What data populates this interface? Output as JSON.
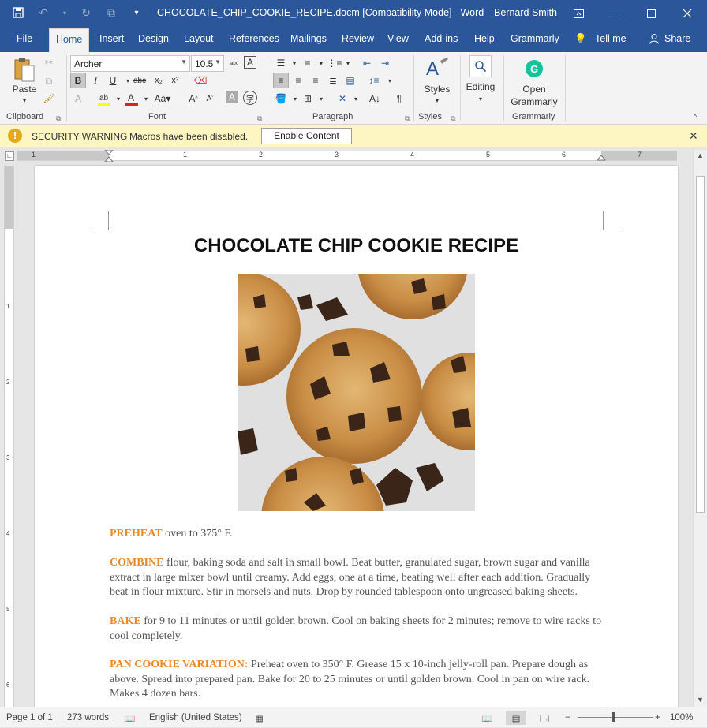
{
  "titlebar": {
    "doc_title": "CHOCOLATE_CHIP_COOKIE_RECIPE.docm [Compatibility Mode]  -  Word",
    "user": "Bernard Smith"
  },
  "tabs": [
    "File",
    "Home",
    "Insert",
    "Design",
    "Layout",
    "References",
    "Mailings",
    "Review",
    "View",
    "Add-ins",
    "Help",
    "Grammarly",
    "Tell me",
    "Share"
  ],
  "ribbon": {
    "clipboard": {
      "paste_label": "Paste",
      "group_label": "Clipboard"
    },
    "font": {
      "font_name": "Archer",
      "font_size": "10.5",
      "group_label": "Font"
    },
    "paragraph": {
      "group_label": "Paragraph"
    },
    "styles": {
      "styles_label": "Styles",
      "group_label": "Styles"
    },
    "editing": {
      "editing_label": "Editing"
    },
    "grammarly": {
      "open_label_1": "Open",
      "open_label_2": "Grammarly",
      "group_label": "Grammarly"
    },
    "accent": "#2b579a"
  },
  "warning": {
    "title": "SECURITY WARNING",
    "message": "Macros have been disabled.",
    "button": "Enable Content"
  },
  "ruler": {
    "h_numbers": [
      "1",
      "1",
      "2",
      "3",
      "4",
      "5",
      "6",
      "7"
    ],
    "v_numbers": [
      "1",
      "2",
      "3",
      "4",
      "5",
      "6"
    ]
  },
  "document": {
    "title": "CHOCOLATE CHIP COOKIE RECIPE",
    "paragraphs": [
      {
        "keyword": "PREHEAT",
        "text": " oven to 375° F."
      },
      {
        "keyword": "COMBINE",
        "text": " flour, baking soda and salt in small bowl. Beat butter, granulated sugar, brown sugar and vanilla extract in large mixer bowl until creamy. Add eggs, one at a time, beating well after each addition. Gradually beat in flour mixture. Stir in morsels and nuts. Drop by rounded tablespoon onto ungreased baking sheets."
      },
      {
        "keyword": "BAKE",
        "text": " for 9 to 11 minutes or until golden brown. Cool on baking sheets for 2 minutes; remove to wire racks to cool completely."
      },
      {
        "keyword": "PAN COOKIE VARIATION:",
        "text": " Preheat oven to 350° F. Grease 15 x 10-inch jelly-roll pan. Prepare dough as above. Spread into prepared pan. Bake for 20 to 25 minutes or until golden brown. Cool in pan on wire rack. Makes 4 dozen bars."
      }
    ],
    "keyword_color": "#e8892b"
  },
  "status": {
    "page": "Page 1 of 1",
    "words": "273 words",
    "language": "English (United States)",
    "zoom": "100%"
  }
}
